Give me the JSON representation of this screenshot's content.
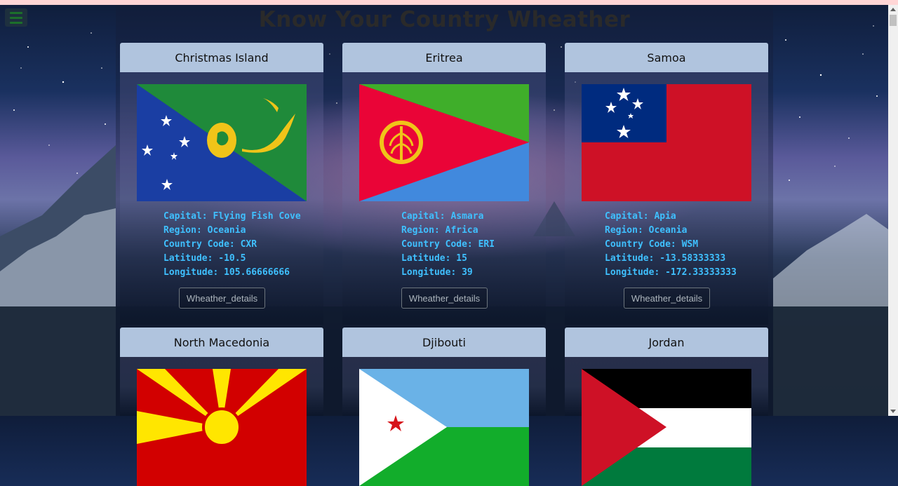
{
  "page": {
    "title": "Know Your Country Wheather",
    "menu_icon": "hamburger-menu-icon"
  },
  "cards": [
    {
      "name": "Christmas Island",
      "flag": "christmas-island-flag",
      "capital": "Capital: Flying Fish Cove",
      "region": "Region: Oceania",
      "code": "Country Code: CXR",
      "lat": "Latitude: -10.5",
      "lng": "Longitude: 105.66666666",
      "button": "Wheather_details"
    },
    {
      "name": "Eritrea",
      "flag": "eritrea-flag",
      "capital": "Capital: Asmara",
      "region": "Region: Africa",
      "code": "Country Code: ERI",
      "lat": "Latitude: 15",
      "lng": "Longitude: 39",
      "button": "Wheather_details"
    },
    {
      "name": "Samoa",
      "flag": "samoa-flag",
      "capital": "Capital: Apia",
      "region": "Region: Oceania",
      "code": "Country Code: WSM",
      "lat": "Latitude: -13.58333333",
      "lng": "Longitude: -172.33333333",
      "button": "Wheather_details"
    },
    {
      "name": "North Macedonia",
      "flag": "north-macedonia-flag"
    },
    {
      "name": "Djibouti",
      "flag": "djibouti-flag"
    },
    {
      "name": "Jordan",
      "flag": "jordan-flag"
    }
  ],
  "colors": {
    "card_header": "#b0c4de",
    "info_text": "#3fc0ff",
    "button_border": "#6c757d",
    "button_text": "#adb5bd"
  }
}
